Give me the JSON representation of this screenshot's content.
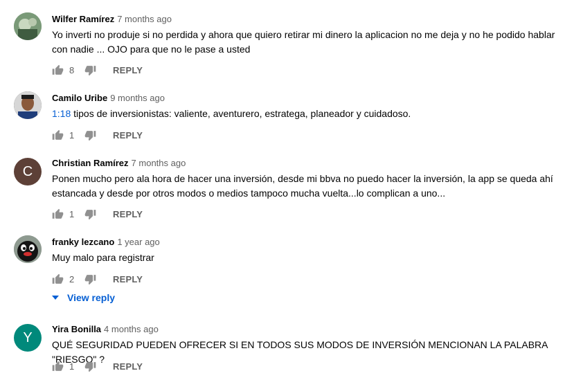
{
  "comments": [
    {
      "author": "Wilfer Ramírez",
      "time": "7 months ago",
      "text": "Yo inverti no produje si no perdida y ahora que quiero retirar mi dinero la aplicacion no me deja y no he podido hablar con nadie ... OJO para  que no le pase a usted",
      "likes": "8",
      "avatar_type": "photo-green"
    },
    {
      "author": "Camilo Uribe",
      "time": "9 months ago",
      "timestamp_link": "1:18",
      "text": " tipos de inversionistas: valiente, aventurero, estratega, planeador y cuidadoso.",
      "likes": "1",
      "avatar_type": "photo-man"
    },
    {
      "author": "Christian Ramírez",
      "time": "7 months ago",
      "text": "Ponen mucho pero ala hora de hacer una inversión, desde mi bbva no puedo hacer  la inversión, la app se queda ahí estancada y desde por otros modos o medios tampoco mucha vuelta...lo complican a uno...",
      "likes": "1",
      "avatar_letter": "C",
      "avatar_color": "#5d4037"
    },
    {
      "author": "franky lezcano",
      "time": "1 year ago",
      "text": "Muy malo para registrar",
      "likes": "2",
      "avatar_type": "photo-penguin",
      "view_reply": "View reply"
    },
    {
      "author": "Yira Bonilla",
      "time": "4 months ago",
      "text": "QUÉ SEGURIDAD PUEDEN OFRECER SI EN TODOS SUS MODOS DE INVERSIÓN MENCIONAN LA PALABRA \"RIESGO\" ?",
      "likes": "1",
      "avatar_letter": "Y",
      "avatar_color": "#00897b"
    }
  ],
  "reply_label": "REPLY",
  "icons": {
    "like": "thumbs-up-icon",
    "dislike": "thumbs-down-icon",
    "expand": "caret-down-icon"
  },
  "colors": {
    "link": "#065fd4",
    "secondary_text": "#606060"
  }
}
